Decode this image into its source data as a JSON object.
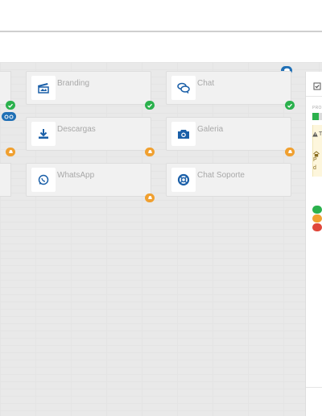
{
  "colors": {
    "brand_blue": "#1a5fa8",
    "status_green": "#2bb14d",
    "status_orange": "#f0a030",
    "status_red": "#e0473a",
    "badge_blue": "#1f6fb5"
  },
  "cards": [
    {
      "label": "Branding",
      "icon": "branding-icon",
      "status": "check"
    },
    {
      "label": "Chat",
      "icon": "chat-icon",
      "status": "check",
      "corner": "chat-bubble"
    },
    {
      "label": "Descargas",
      "icon": "download-icon",
      "status": "pending"
    },
    {
      "label": "Galeria",
      "icon": "camera-icon",
      "status": "pending"
    },
    {
      "label": "WhatsApp",
      "icon": "whatsapp-icon",
      "status": "pending"
    },
    {
      "label": "Chat Soporte",
      "icon": "support-icon",
      "status": "none"
    }
  ],
  "left_column_badges": [
    "check",
    "views",
    "pending"
  ],
  "side_panel": {
    "header_icon": "checklist-icon",
    "progress_label": "PRO",
    "progress_fraction": 0.65,
    "warning_icon": "warning-icon",
    "warning_text": "T",
    "warning_body_icon": "home-icon",
    "warning_body_text": "P",
    "warning_body_text2": "d",
    "legend": [
      "check",
      "pending",
      "alert"
    ]
  }
}
